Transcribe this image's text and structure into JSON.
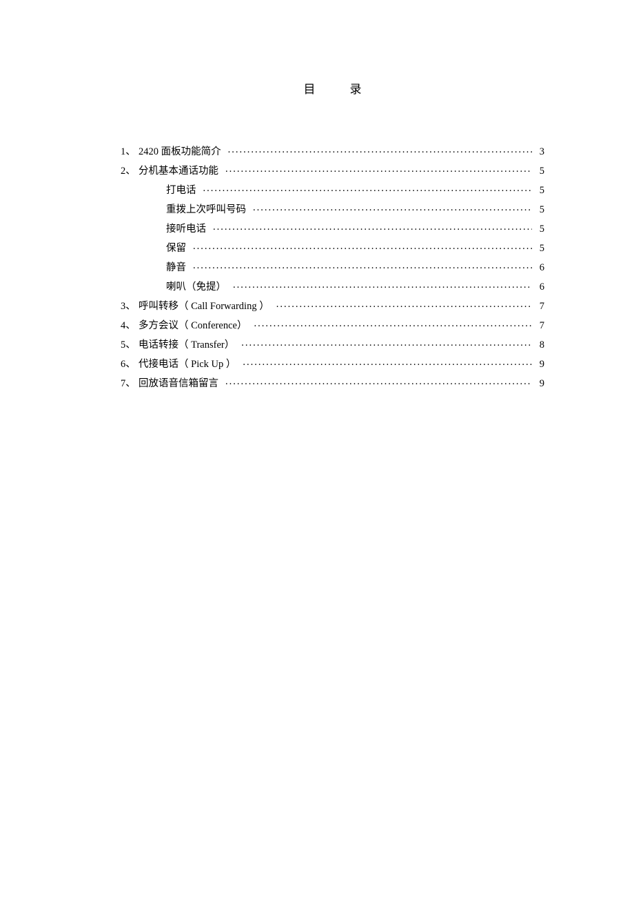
{
  "title": "目录",
  "toc": [
    {
      "num": "1、",
      "label": "2420 面板功能简介",
      "page": "3",
      "indent": false
    },
    {
      "num": "2、",
      "label": "分机基本通话功能",
      "page": "5",
      "indent": false
    },
    {
      "num": "",
      "label": "打电话",
      "page": "5",
      "indent": true
    },
    {
      "num": "",
      "label": "重拨上次呼叫号码",
      "page": "5",
      "indent": true
    },
    {
      "num": "",
      "label": "接听电话",
      "page": "5",
      "indent": true
    },
    {
      "num": "",
      "label": "保留",
      "page": "5",
      "indent": true
    },
    {
      "num": "",
      "label": "静音",
      "page": "6",
      "indent": true
    },
    {
      "num": "",
      "label": "喇叭（免提）",
      "page": "6",
      "indent": true
    },
    {
      "num": "3、",
      "label": "呼叫转移（ Call Forwarding ）",
      "page": "7",
      "indent": false
    },
    {
      "num": "4、",
      "label": "多方会议（ Conference）",
      "page": "7",
      "indent": false
    },
    {
      "num": "5、",
      "label": "电话转接（ Transfer）",
      "page": "8",
      "indent": false
    },
    {
      "num": "6、",
      "label": "代接电话（ Pick Up ）",
      "page": "9",
      "indent": false
    },
    {
      "num": "7、",
      "label": "回放语音信箱留言",
      "page": "9",
      "indent": false
    }
  ]
}
